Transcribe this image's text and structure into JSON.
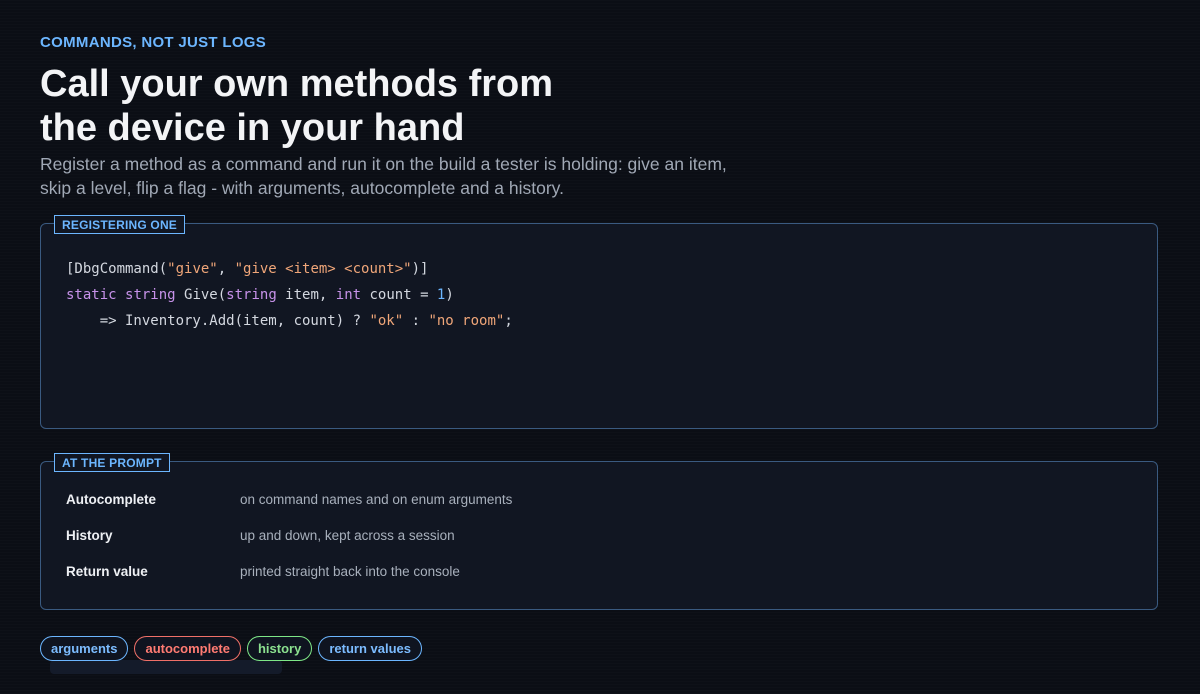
{
  "header": {
    "eyebrow": "COMMANDS, NOT JUST LOGS",
    "title_line1": "Call your own methods from",
    "title_line2": "the device in your hand",
    "subtitle": "Register a method as a command and run it on the build a tester is holding: give an item, skip a level, flip a flag - with arguments, autocomplete and a history."
  },
  "code_panel": {
    "label": "REGISTERING ONE",
    "lines": [
      [
        {
          "t": "[DbgCommand(",
          "c": "def"
        },
        {
          "t": "\"give\"",
          "c": "str"
        },
        {
          "t": ", ",
          "c": "def"
        },
        {
          "t": "\"give <item> <count>\"",
          "c": "str"
        },
        {
          "t": ")]",
          "c": "def"
        }
      ],
      [
        {
          "t": "static",
          "c": "kw"
        },
        {
          "t": " ",
          "c": "def"
        },
        {
          "t": "string",
          "c": "kw"
        },
        {
          "t": " Give(",
          "c": "def"
        },
        {
          "t": "string",
          "c": "kw"
        },
        {
          "t": " item, ",
          "c": "def"
        },
        {
          "t": "int",
          "c": "kw"
        },
        {
          "t": " count = ",
          "c": "def"
        },
        {
          "t": "1",
          "c": "num"
        },
        {
          "t": ")",
          "c": "def"
        }
      ],
      [
        {
          "t": "    => Inventory.Add(item, count) ? ",
          "c": "def"
        },
        {
          "t": "\"ok\"",
          "c": "str"
        },
        {
          "t": " : ",
          "c": "def"
        },
        {
          "t": "\"no room\"",
          "c": "str"
        },
        {
          "t": ";",
          "c": "def"
        }
      ]
    ]
  },
  "prompt_panel": {
    "label": "AT THE PROMPT",
    "rows": [
      {
        "key": "Autocomplete",
        "value": "on command names and on enum arguments"
      },
      {
        "key": "History",
        "value": "up and down, kept across a session"
      },
      {
        "key": "Return value",
        "value": "printed straight back into the console"
      }
    ]
  },
  "tags": [
    {
      "label": "arguments",
      "color": "#6cb6ff"
    },
    {
      "label": "autocomplete",
      "color": "#f07068"
    },
    {
      "label": "history",
      "color": "#7ee787"
    },
    {
      "label": "return values",
      "color": "#6cb6ff"
    }
  ],
  "colors": {
    "accent": "#6cb6ff",
    "background": "#0b0e15",
    "panel": "#111622",
    "string": "#f0a679",
    "keyword": "#c792ea",
    "number": "#6cb6ff"
  }
}
